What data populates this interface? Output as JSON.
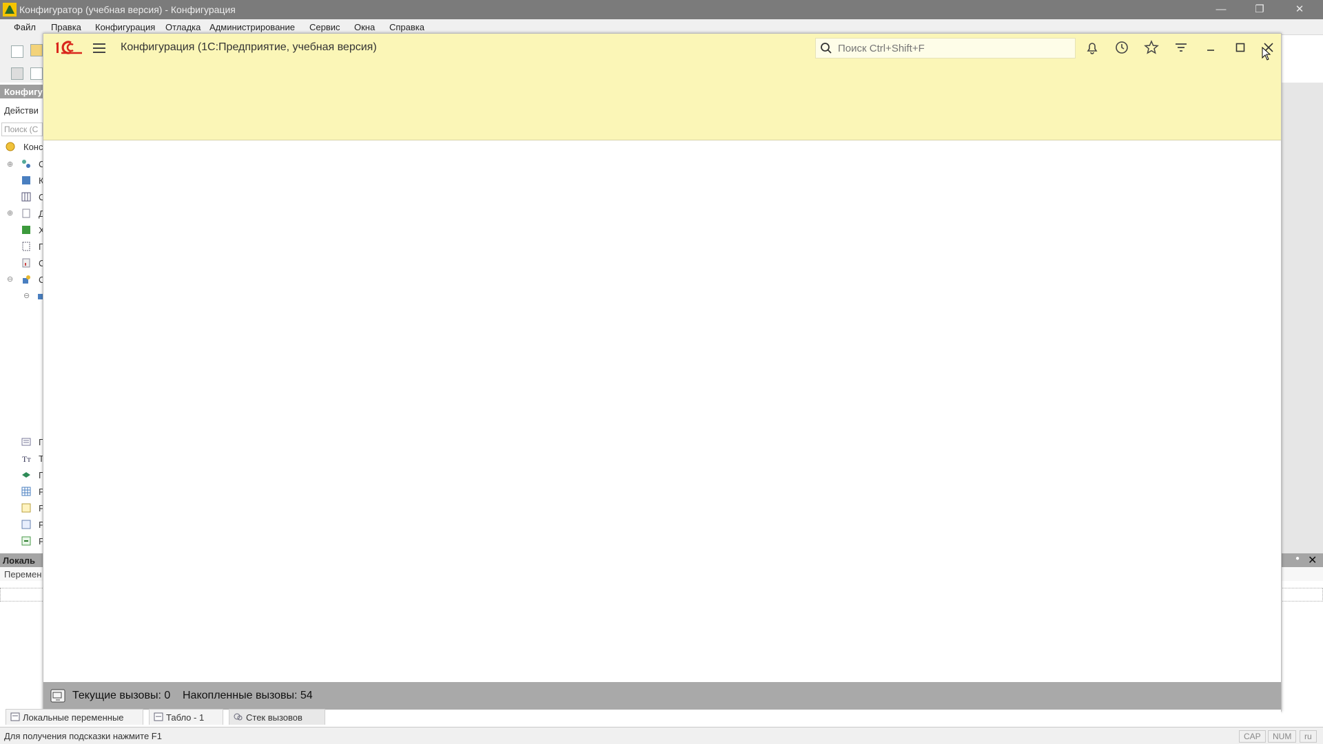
{
  "outer_window": {
    "title": "Конфигуратор (учебная версия) - Конфигурация",
    "menu": [
      "Файл",
      "Правка",
      "Конфигурация",
      "Отладка",
      "Администрирование",
      "Сервис",
      "Окна",
      "Справка"
    ]
  },
  "left_panel": {
    "header": "Конфигу",
    "actions_label": "Действи",
    "search_placeholder": "Поиск (С",
    "root_label": "Конс",
    "items": [
      "С",
      "К",
      "С",
      "Д",
      "Х",
      "П",
      "С",
      "С",
      "",
      "",
      "П",
      "Т",
      "Г",
      "Р",
      "Р",
      "Р",
      "Р"
    ]
  },
  "bottom_outer": {
    "header": "Локаль",
    "sub": "Перемен"
  },
  "enterprise_window": {
    "title": "Конфигурация  (1С:Предприятие, учебная версия)",
    "search_placeholder": "Поиск Ctrl+Shift+F",
    "status": {
      "current_calls": "Текущие вызовы: 0",
      "accumulated_calls": "Накопленные вызовы: 54"
    }
  },
  "bottom_tabs": [
    "Локальные переменные",
    "Табло - 1",
    "Стек вызовов"
  ],
  "statusbar": {
    "hint": "Для получения подсказки нажмите F1",
    "indicators": [
      "CAP",
      "NUM",
      "ru"
    ]
  },
  "colors": {
    "enterprise_header": "#fbf6b7",
    "logo_red": "#d9261c",
    "status_gray": "#a9a9a9",
    "outer_titlebar": "#7b7b7b"
  }
}
